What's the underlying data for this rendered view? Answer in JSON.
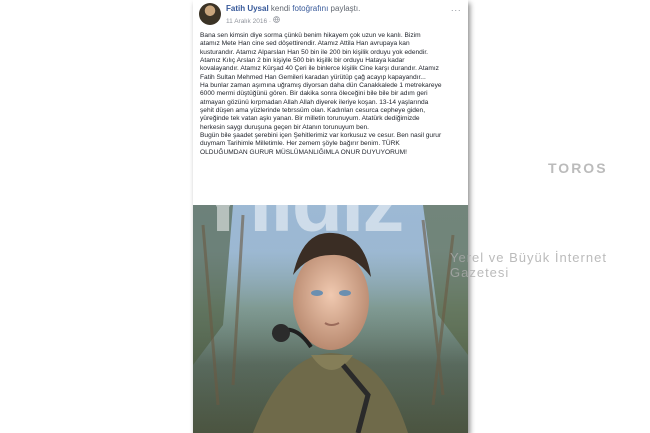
{
  "post": {
    "author": "Fatih Uysal",
    "action_prefix": "kendi",
    "action_link": "fotoğrafını",
    "action_suffix": "paylaştı.",
    "date": "11 Aralık 2016",
    "privacy_icon": "globe-icon",
    "more_label": "...",
    "paragraphs": [
      "Bana sen kimsin diye sorma çünkü benim hikayem çok uzun ve kanlı. Bizim atamız Mete Han cine sed döşettirendir. Atamız Attila Han avrupaya kan kusturandır. Atamız Alparslan Han 50 bin ile 200 bin kişilik orduyu yok edendir. Atamız Kılıç Arslan 2 bin kişiyle 500 bin kişilik bir orduyu Hataya kadar kovalayandır. Atamız Kürşad 40 Çeri ile binlerce kişilik Cine karşı durandır. Atamız Fatih Sultan Mehmed Han Gemileri karadan yürütüp çağ acayıp kapayandır...",
      "Ha bunlar zaman aşımına uğramış diyorsan daha dün Canakkalede 1 metrekareye 6000 mermi düştüğünü gören. Bir dakika sonra öleceğini bile bile bir adım geri atmayan gözünü kırpmadan Allah Allah diyerek ileriye koşan. 13-14 yaşlarında şehit düşen ama yüzlerinde tebrssüm olan. Kadınları cesurca cepheye giden, yüreğinde tek vatan aşkı yanan. Bir milletin torunuyum. Atatürk dediğimizde herkesin saygı duruşuna geçen bir Atanın torunuyum ben.",
      "Bugün bile şaadet şerebini içen Şehitlerimiz var korkusuz ve cesur. Ben nasil gurur duymam Tarihimle Milletimle. Her zemem şöyle bağırır benim. TÜRK OLDUĞUMDAN GURUR MÜSLÜMANLIĞIMLA ONUR DUYUYORUM!"
    ]
  },
  "watermark": {
    "brand": "Yıldız",
    "tagline_top": "TOROS",
    "tagline_bottom": "Yerel ve Büyük İnternet Gazetesi"
  },
  "colors": {
    "link": "#365899",
    "text": "#1d2129",
    "meta": "#90949c"
  }
}
